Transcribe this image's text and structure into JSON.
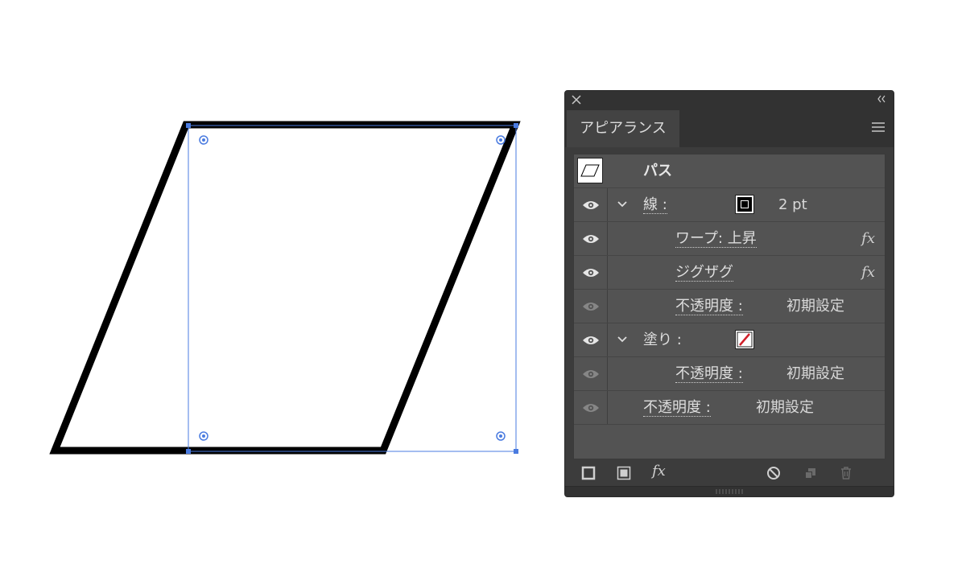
{
  "panel": {
    "tab": "アピアランス",
    "path_title": "パス",
    "stroke": {
      "label": "線 :",
      "weight": "2 pt"
    },
    "effects": [
      {
        "label": "ワープ: 上昇",
        "fx": "fx"
      },
      {
        "label": "ジグザグ",
        "fx": "fx"
      }
    ],
    "stroke_opacity": {
      "label": "不透明度 :",
      "value": "初期設定"
    },
    "fill": {
      "label": "塗り :"
    },
    "fill_opacity": {
      "label": "不透明度 :",
      "value": "初期設定"
    },
    "object_opacity": {
      "label": "不透明度 :",
      "value": "初期設定"
    },
    "bottom_fx": "fx"
  },
  "colors": {
    "selection": "#4a7be0",
    "panel_bg": "#535353",
    "stroke": "#000000",
    "fill_none_slash": "#d0202a"
  },
  "icons": [
    "close-icon",
    "collapse-icon",
    "menu-icon",
    "eye-icon",
    "chevron-down-icon",
    "add-stroke-icon",
    "add-fill-icon",
    "clear-appearance-icon",
    "duplicate-icon",
    "trash-icon"
  ]
}
